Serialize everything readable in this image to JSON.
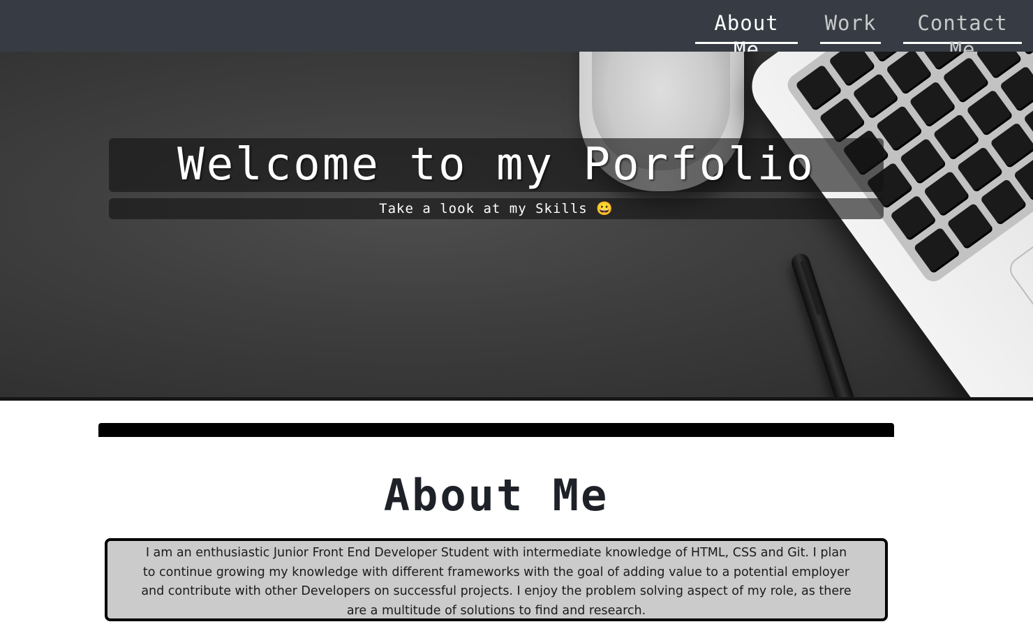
{
  "nav": {
    "items": [
      {
        "label": "About Me",
        "active": true
      },
      {
        "label": "Work",
        "active": false
      },
      {
        "label": "Contact Me",
        "active": false
      }
    ]
  },
  "hero": {
    "title": "Welcome to my Porfolio",
    "subtitle": "Take a look at my Skills 😀"
  },
  "about": {
    "heading": "About Me",
    "body": "I am an enthusiastic Junior Front End Developer Student with intermediate knowledge of HTML, CSS and Git. I plan to continue growing my knowledge with different frameworks with the goal of adding value to a potential employer and contribute with other Developers on successful projects. I enjoy the problem solving aspect of my role, as there are a multitude of solutions to find and research."
  },
  "colors": {
    "nav_background": "#373c44",
    "nav_active_text": "#ffffff",
    "nav_inactive_text": "#c9c9c9",
    "about_box_background": "#cbcbcb",
    "divider": "#000000"
  }
}
